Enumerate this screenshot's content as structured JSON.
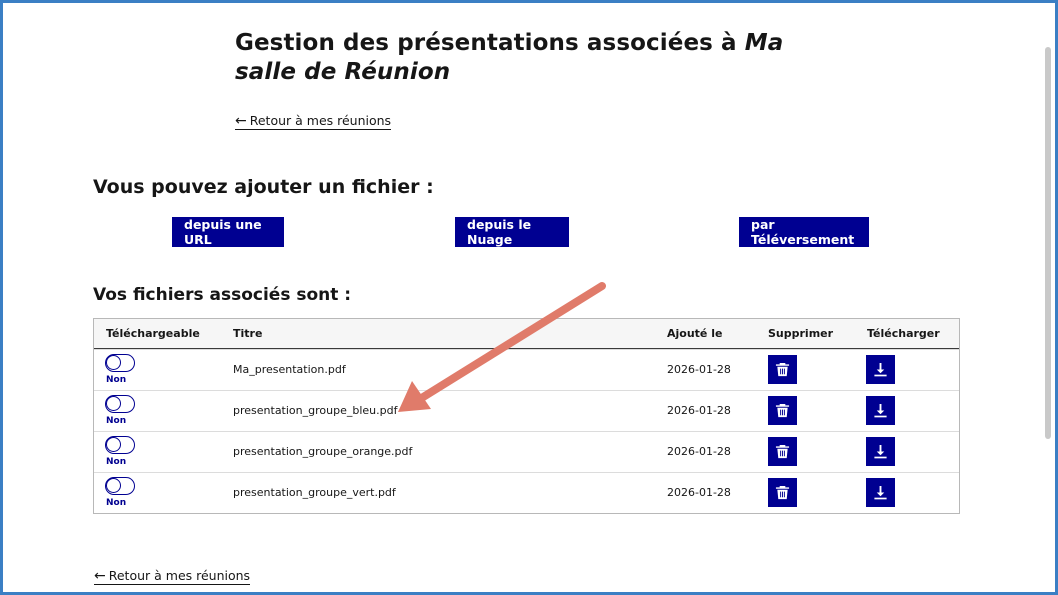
{
  "page": {
    "title_plain": "Gestion des présentations associées à ",
    "title_room": "Ma salle de Réunion",
    "back_link_top": "Retour à mes réunions",
    "back_link_bottom": "Retour à mes réunions"
  },
  "add_section": {
    "heading": "Vous pouvez ajouter un fichier :",
    "buttons": {
      "url": "depuis une URL",
      "cloud": "depuis le Nuage",
      "upload": "par Téléversement"
    }
  },
  "files_section": {
    "heading": "Vos fichiers associés sont :",
    "columns": {
      "downloadable": "Téléchargeable",
      "title": "Titre",
      "added": "Ajouté le",
      "delete": "Supprimer",
      "download": "Télécharger"
    },
    "rows": [
      {
        "downloadable": "Non",
        "title": "Ma_presentation.pdf",
        "added": "2026-01-28"
      },
      {
        "downloadable": "Non",
        "title": "presentation_groupe_bleu.pdf",
        "added": "2026-01-28"
      },
      {
        "downloadable": "Non",
        "title": "presentation_groupe_orange.pdf",
        "added": "2026-01-28"
      },
      {
        "downloadable": "Non",
        "title": "presentation_groupe_vert.pdf",
        "added": "2026-01-28"
      }
    ]
  },
  "icons": {
    "back": "arrow-left-icon",
    "delete": "trash-icon",
    "download": "download-icon",
    "annotation": "annotation-arrow-icon"
  },
  "colors": {
    "primary": "#000091",
    "annotation_arrow": "#e07b6a",
    "frame_border": "#3b7fc4"
  }
}
